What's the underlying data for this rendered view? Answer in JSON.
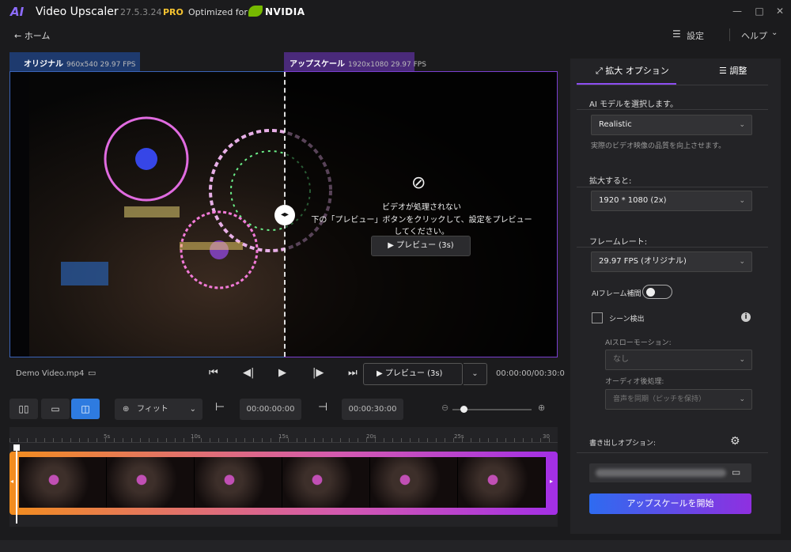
{
  "app": {
    "logo": "AI",
    "name": "Video Upscaler",
    "version": "27.5.3.24",
    "pro": "PRO",
    "optimized": "Optimized for",
    "nvidia": "NVIDIA"
  },
  "nav": {
    "home": "← ホーム",
    "settings": "設定",
    "help": "ヘルプ"
  },
  "viewer": {
    "original_tab": "オリジナル",
    "original_info": "960x540 29.97 FPS",
    "upscale_tab": "アップスケール",
    "upscale_info": "1920x1080 29.97 FPS",
    "msg_title": "ビデオが処理されない",
    "msg_body": "下の「プレビュー」ボタンをクリックして、設定をプレビューしてください。",
    "preview_btn": "プレビュー (3s)"
  },
  "controls": {
    "filename": "Demo Video.mp4",
    "preview_btn": "プレビュー (3s)",
    "time": "00:00:00/00:30:0"
  },
  "toolbar": {
    "zoom": "フィット",
    "start_time": "00:00:00:00",
    "end_time": "00:00:30:00"
  },
  "timeline": {
    "ticks": [
      "5s",
      "10s",
      "15s",
      "20s",
      "25s",
      "30"
    ],
    "frames": 6
  },
  "panel": {
    "tab_expand": "拡大 オプション",
    "tab_adjust": "調整",
    "model_label": "AI モデルを選択します。",
    "model_value": "Realistic",
    "model_hint": "実際のビデオ映像の品質を向上させます。",
    "scale_label": "拡大すると:",
    "scale_value": "1920 * 1080 (2x)",
    "fps_label": "フレームレート:",
    "fps_value": "29.97 FPS (オリジナル)",
    "interp_label": "AIフレーム補間",
    "interp_on": false,
    "scene_label": "シーン検出",
    "scene_checked": false,
    "slowmo_label": "AIスローモーション:",
    "slowmo_value": "なし",
    "audio_label": "オーディオ後処理:",
    "audio_value": "音声を同期（ピッチを保持）",
    "export_label": "書き出しオプション:",
    "start_btn": "アップスケールを開始"
  },
  "colors": {
    "accent_blue": "#2e7be0",
    "accent_purple": "#8d4df0",
    "orig_tab": "#1e3a6e",
    "up_tab": "#4a2a7a",
    "pro": "#f5c330",
    "nvidia": "#76b900"
  },
  "icons": [
    "app-logo-icon",
    "nvidia-eye-icon",
    "minimize-icon",
    "maximize-icon",
    "close-icon",
    "settings-sliders-icon",
    "chevron-down-icon",
    "camera-off-icon",
    "play-icon",
    "skip-start-icon",
    "frame-back-icon",
    "frame-forward-icon",
    "skip-end-icon",
    "folder-icon",
    "zoom-in-icon",
    "zoom-out-icon",
    "gear-icon",
    "info-icon",
    "expand-icon",
    "adjust-icon"
  ]
}
